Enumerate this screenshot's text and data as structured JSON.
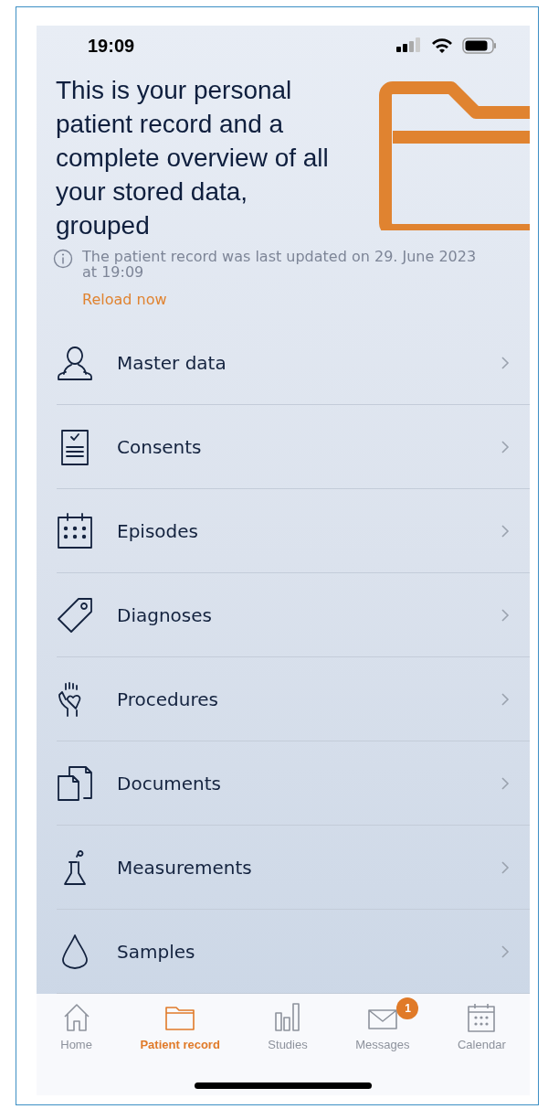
{
  "status_bar": {
    "time": "19:09"
  },
  "header": {
    "title": "This is your personal patient record and a complete overview of all your stored data, grouped"
  },
  "update_notice": {
    "text": "The patient record was last updated on 29. June 2023 at 19:09",
    "link": "Reload now"
  },
  "items": [
    {
      "label": "Master data",
      "kind": "person"
    },
    {
      "label": "Consents",
      "kind": "consent"
    },
    {
      "label": "Episodes",
      "kind": "calendar"
    },
    {
      "label": "Diagnoses",
      "kind": "tag"
    },
    {
      "label": "Procedures",
      "kind": "hand"
    },
    {
      "label": "Documents",
      "kind": "documents"
    },
    {
      "label": "Measurements",
      "kind": "flask"
    },
    {
      "label": "Samples",
      "kind": "drop"
    }
  ],
  "tab_bar": [
    {
      "label": "Home",
      "kind": "home",
      "selected": false
    },
    {
      "label": "Patient record",
      "kind": "folder",
      "selected": true
    },
    {
      "label": "Studies",
      "kind": "bars",
      "selected": false
    },
    {
      "label": "Messages",
      "kind": "mail",
      "selected": false,
      "badge": "1"
    },
    {
      "label": "Calendar",
      "kind": "calendar",
      "selected": false
    }
  ]
}
